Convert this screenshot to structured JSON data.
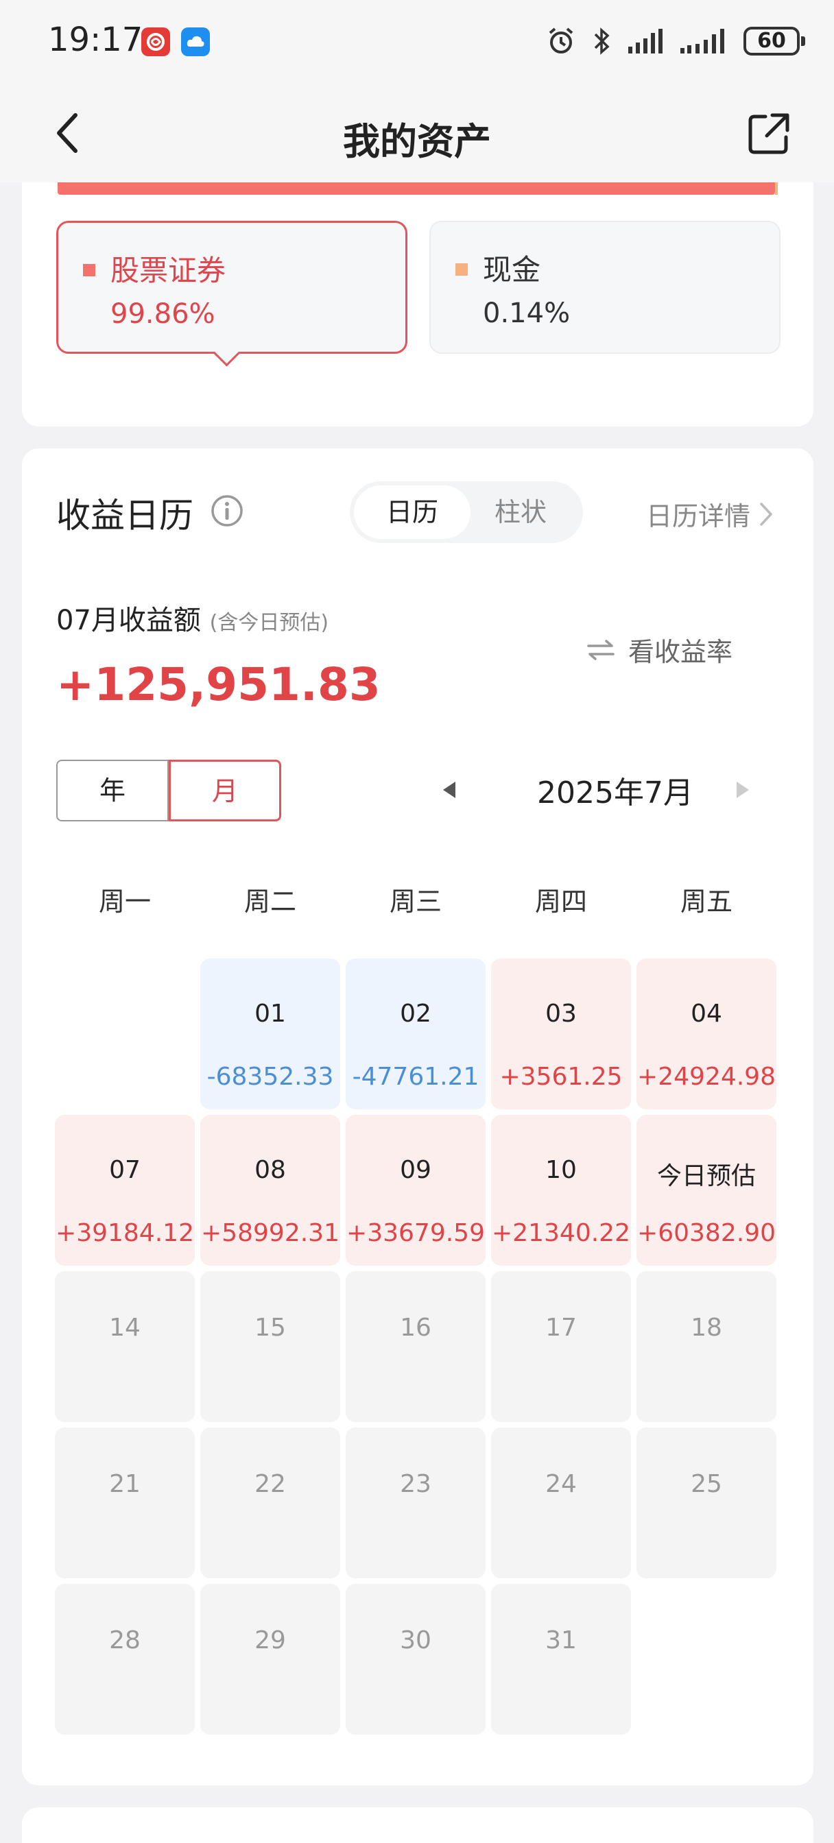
{
  "status_bar": {
    "time": "19:17",
    "battery": "60"
  },
  "header": {
    "title": "我的资产"
  },
  "allocation": {
    "stock": {
      "name": "股票证券",
      "pct": "99.86%",
      "color": "#f4716c"
    },
    "cash": {
      "name": "现金",
      "pct": "0.14%",
      "color": "#f5b27f"
    },
    "progress": 0.9986
  },
  "calendar": {
    "title": "收益日历",
    "tabs": {
      "calendar": "日历",
      "bar": "柱状"
    },
    "detail_link": "日历详情",
    "month_label": "07月收益额",
    "month_note": "(含今日预估)",
    "toggle_rate": "看收益率",
    "month_amount": "+125,951.83",
    "toggle": {
      "year": "年",
      "month": "月"
    },
    "current_month": "2025年7月",
    "weekdays": [
      "周一",
      "周二",
      "周三",
      "周四",
      "周五"
    ],
    "days": [
      {
        "label": "01",
        "value": "-68352.33",
        "kind": "neg"
      },
      {
        "label": "02",
        "value": "-47761.21",
        "kind": "neg"
      },
      {
        "label": "03",
        "value": "+3561.25",
        "kind": "pos"
      },
      {
        "label": "04",
        "value": "+24924.98",
        "kind": "pos"
      },
      {
        "label": "07",
        "value": "+39184.12",
        "kind": "pos"
      },
      {
        "label": "08",
        "value": "+58992.31",
        "kind": "pos"
      },
      {
        "label": "09",
        "value": "+33679.59",
        "kind": "pos"
      },
      {
        "label": "10",
        "value": "+21340.22",
        "kind": "pos"
      },
      {
        "label": "今日预估",
        "value": "+60382.90",
        "kind": "pos"
      },
      {
        "label": "14",
        "value": "",
        "kind": "future"
      },
      {
        "label": "15",
        "value": "",
        "kind": "future"
      },
      {
        "label": "16",
        "value": "",
        "kind": "future"
      },
      {
        "label": "17",
        "value": "",
        "kind": "future"
      },
      {
        "label": "18",
        "value": "",
        "kind": "future"
      },
      {
        "label": "21",
        "value": "",
        "kind": "future"
      },
      {
        "label": "22",
        "value": "",
        "kind": "future"
      },
      {
        "label": "23",
        "value": "",
        "kind": "future"
      },
      {
        "label": "24",
        "value": "",
        "kind": "future"
      },
      {
        "label": "25",
        "value": "",
        "kind": "future"
      },
      {
        "label": "28",
        "value": "",
        "kind": "future"
      },
      {
        "label": "29",
        "value": "",
        "kind": "future"
      },
      {
        "label": "30",
        "value": "",
        "kind": "future"
      },
      {
        "label": "31",
        "value": "",
        "kind": "future"
      }
    ],
    "colors": {
      "positive": "#e04447",
      "negative": "#4a8ed6"
    }
  }
}
